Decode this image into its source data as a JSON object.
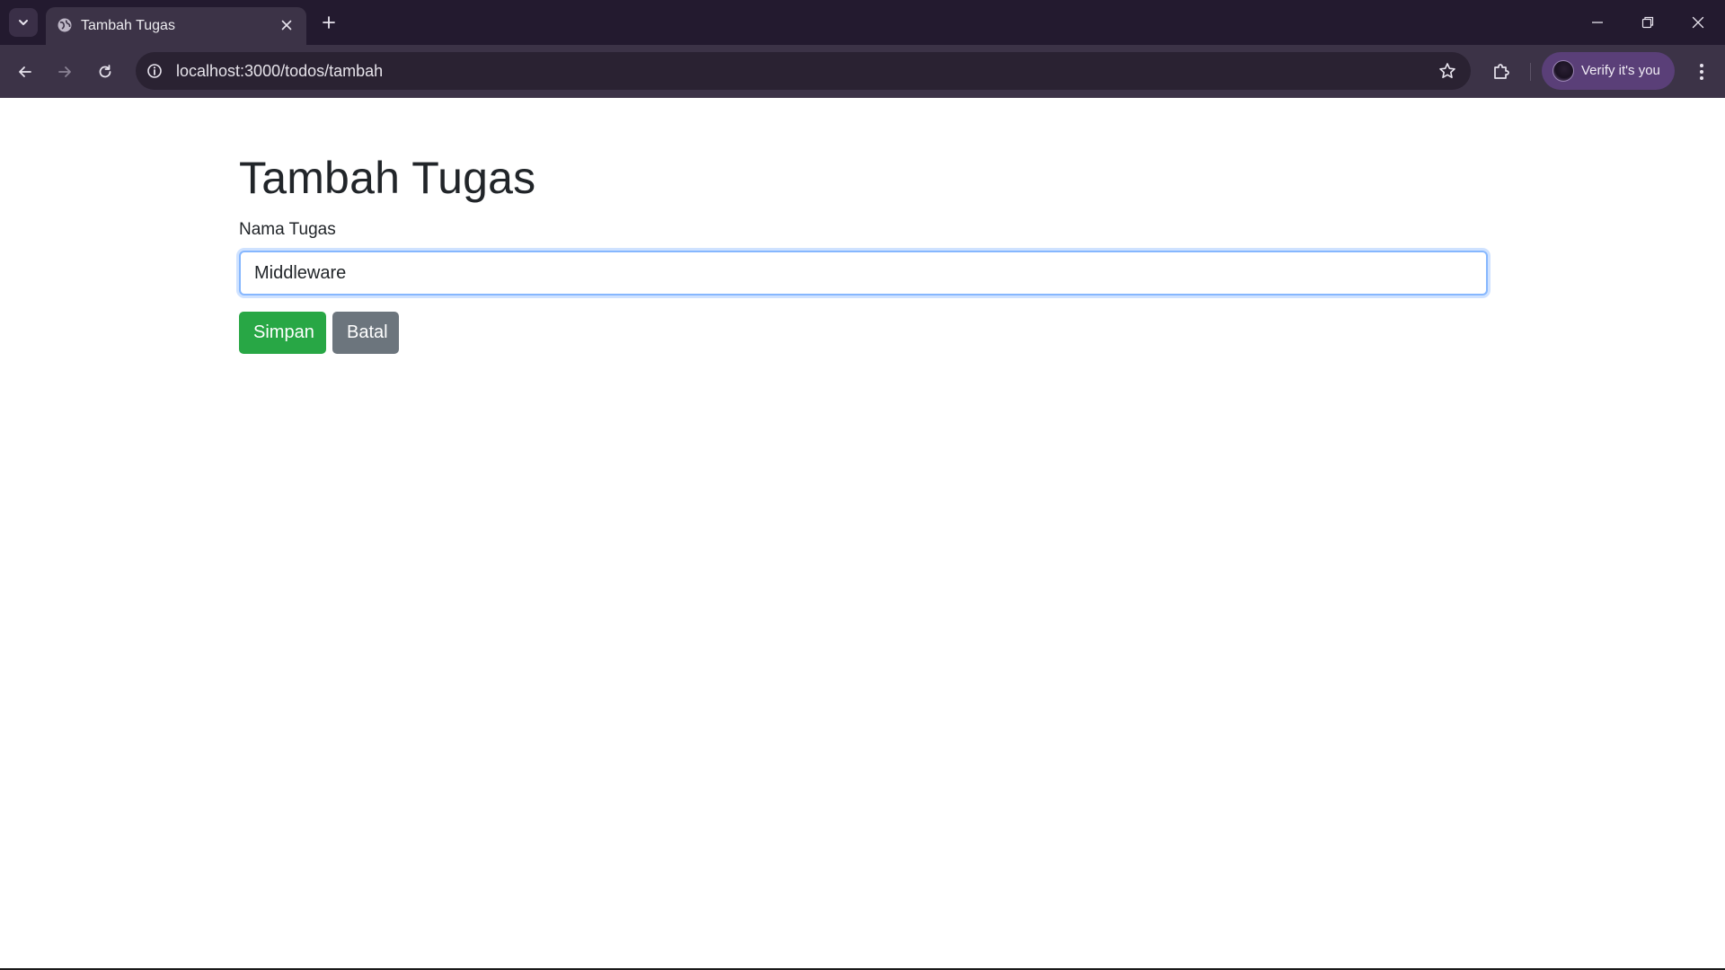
{
  "browser": {
    "tab": {
      "title": "Tambah Tugas"
    },
    "address_bar": {
      "url": "localhost:3000/todos/tambah"
    },
    "profile": {
      "label": "Verify it's you"
    },
    "icons": {
      "tab_search": "chevron-down-icon",
      "favicon": "globe-icon",
      "tab_close": "close-icon",
      "new_tab": "plus-icon",
      "back": "arrow-left-icon",
      "forward": "arrow-right-icon",
      "reload": "reload-icon",
      "site_info": "info-icon",
      "bookmark": "star-icon",
      "extensions": "puzzle-icon",
      "menu": "kebab-menu-icon",
      "minimize": "minimize-icon",
      "restore": "restore-icon",
      "close_window": "close-icon"
    }
  },
  "page": {
    "title": "Tambah Tugas",
    "form": {
      "label": "Nama Tugas",
      "input_value": "Middleware",
      "submit_label": "Simpan",
      "cancel_label": "Batal"
    }
  },
  "colors": {
    "success": "#28a745",
    "secondary": "#6c757d",
    "focus_border": "#86b7fe",
    "chrome_dark": "#231a2f",
    "chrome_toolbar": "#3c3347"
  }
}
